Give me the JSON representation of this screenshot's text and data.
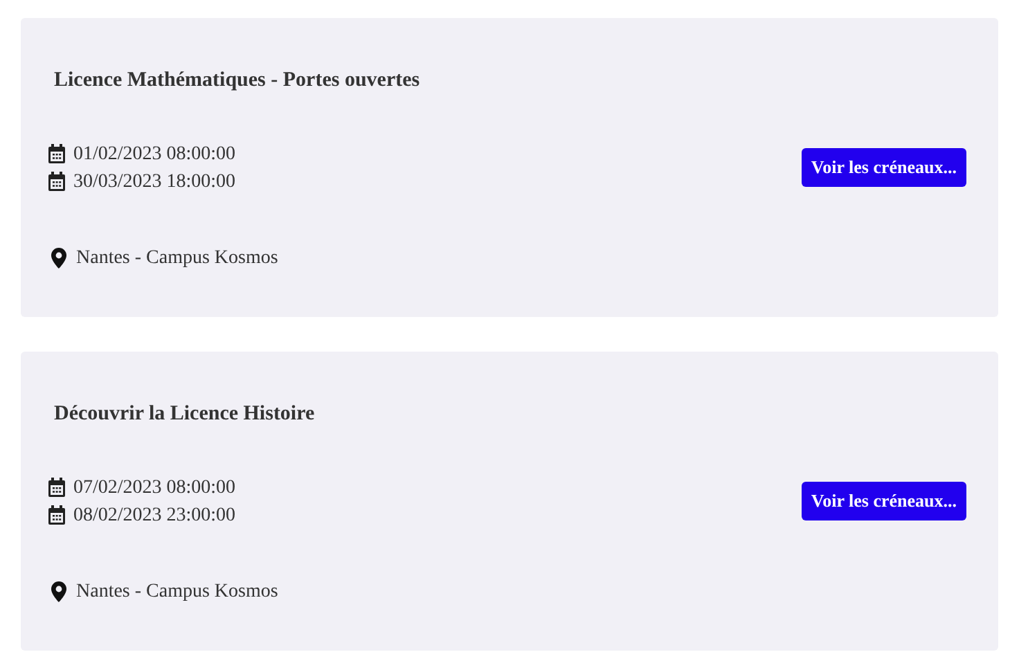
{
  "events": [
    {
      "title": "Licence Mathématiques - Portes ouvertes",
      "start": "01/02/2023 08:00:00",
      "end": "30/03/2023 18:00:00",
      "location": "Nantes - Campus Kosmos",
      "button": "Voir les créneaux..."
    },
    {
      "title": "Découvrir la Licence Histoire",
      "start": "07/02/2023 08:00:00",
      "end": "08/02/2023 23:00:00",
      "location": "Nantes - Campus Kosmos",
      "button": "Voir les créneaux..."
    }
  ]
}
